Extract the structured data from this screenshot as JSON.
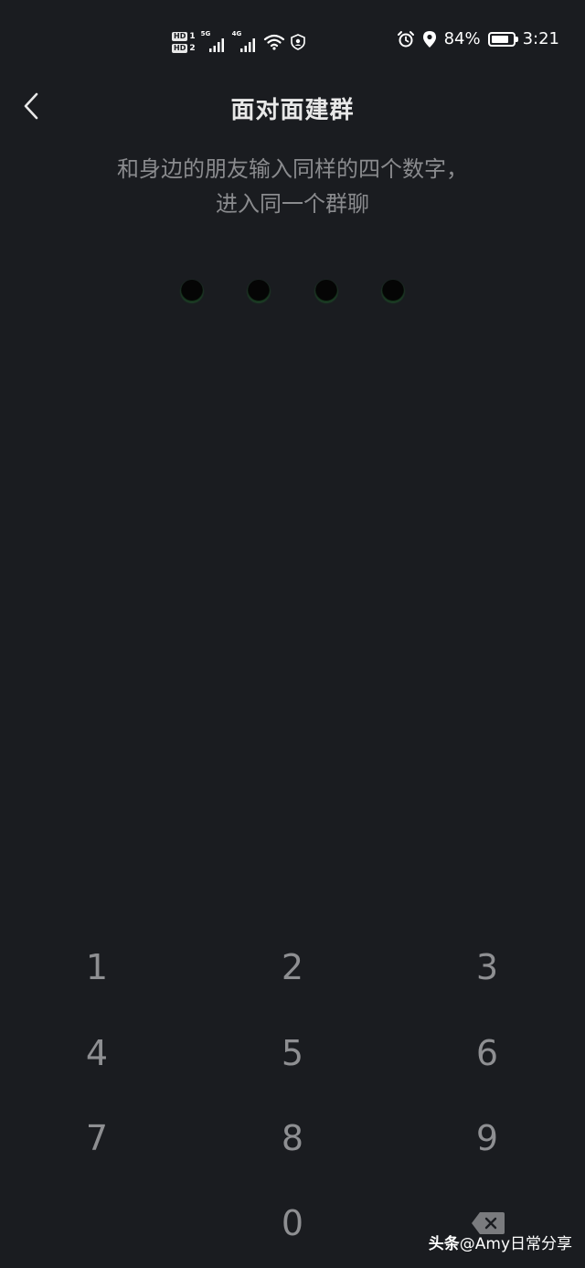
{
  "status_bar": {
    "hd1_label": "HD",
    "hd1_slot": "1",
    "hd2_label": "HD",
    "hd2_slot": "2",
    "sim1_network": "5G",
    "sim2_network": "4G",
    "battery_percent": "84%",
    "battery_level": 0.84,
    "time": "3:21",
    "icons": [
      "signal-icon",
      "signal-icon",
      "wifi-icon",
      "vpn-shield-icon",
      "alarm-icon",
      "location-icon",
      "battery-icon"
    ]
  },
  "nav": {
    "back_icon": "chevron-left-icon",
    "title": "面对面建群"
  },
  "instructions": {
    "line1": "和身边的朋友输入同样的四个数字，",
    "line2": "进入同一个群聊"
  },
  "pin": {
    "length": 4,
    "entered": 0
  },
  "keypad": {
    "keys": [
      "1",
      "2",
      "3",
      "4",
      "5",
      "6",
      "7",
      "8",
      "9",
      "0"
    ],
    "delete_icon": "backspace-icon"
  },
  "watermark": {
    "brand": "头条",
    "handle": "@Amy日常分享"
  },
  "colors": {
    "background": "#1a1c20",
    "text_primary": "#e8e8e8",
    "text_secondary": "#8a8b8e",
    "key_text": "#8e8f92",
    "dot_glow": "#1f5a2a"
  }
}
